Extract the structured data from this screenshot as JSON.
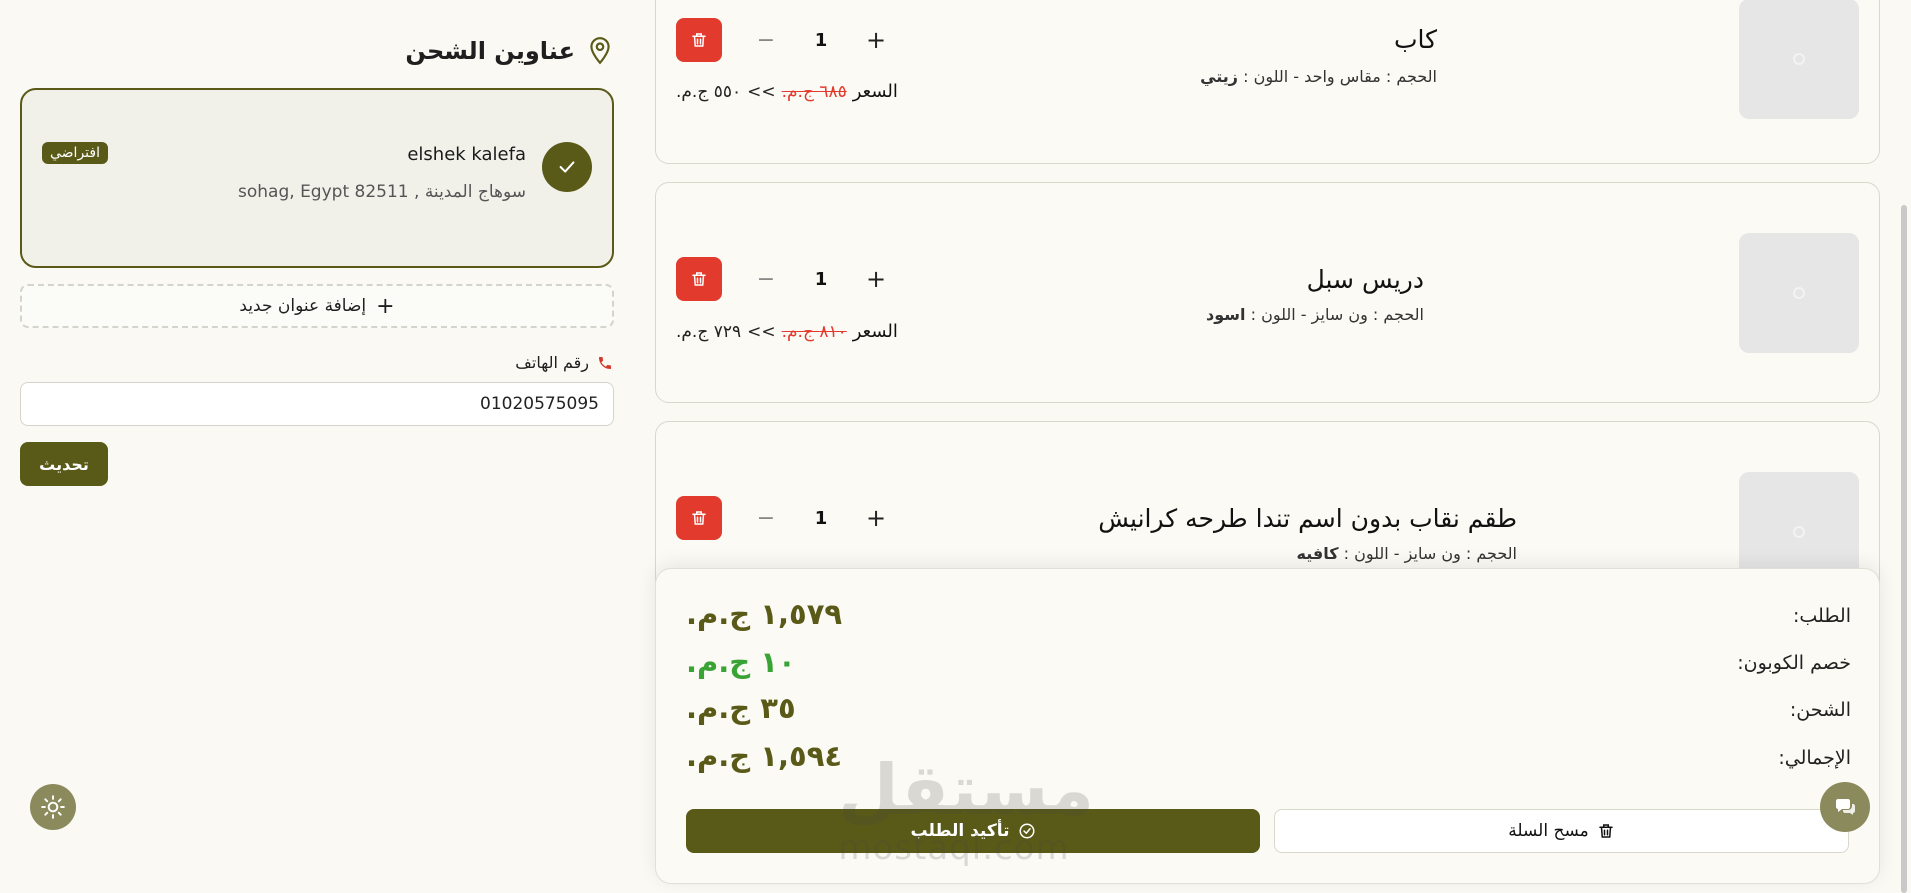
{
  "shipping": {
    "title": "عناوين الشحن",
    "address": {
      "name": "elshek kalefa",
      "line": "سوهاج المدينة , sohag, Egypt 82511",
      "badge": "افتراضي"
    },
    "add_label": "إضافة عنوان جديد",
    "phone_label": "رقم الهاتف",
    "phone_value": "01020575095",
    "update_label": "تحديث"
  },
  "cart": {
    "items": [
      {
        "name": "كاب",
        "size_label": "الحجم :",
        "size": "مقاس واحد",
        "color_label": "اللون :",
        "color": "زيتي",
        "qty": "1",
        "price_label": "السعر",
        "old_price": "٦٨٥ ج.م.",
        "arrow": ">>",
        "new_price": "٥٥٠ ج.م."
      },
      {
        "name": "دريس سبل",
        "size_label": "الحجم :",
        "size": "ون سايز",
        "color_label": "اللون :",
        "color": "اسود",
        "qty": "1",
        "price_label": "السعر",
        "old_price": "٨١٠ ج.م.",
        "arrow": ">>",
        "new_price": "٧٢٩ ج.م."
      },
      {
        "name": "طقم نقاب بدون اسم تندا طرحه كرانيش",
        "size_label": "الحجم :",
        "size": "ون سايز",
        "color_label": "اللون :",
        "color": "كافيه",
        "qty": "1"
      }
    ]
  },
  "summary": {
    "order_label": "الطلب:",
    "order_value": "١,٥٧٩ ج.م.",
    "coupon_label": "خصم الكوبون:",
    "coupon_value": "١٠ ج.م.",
    "shipping_label": "الشحن:",
    "shipping_value": "٣٥ ج.م.",
    "total_label": "الإجمالي:",
    "total_value": "١,٥٩٤ ج.م.",
    "confirm_label": "تأكيد الطلب",
    "clear_label": "مسح السلة"
  },
  "watermark": {
    "arabic": "مستقل",
    "latin": "mostaql.com"
  },
  "colors": {
    "accent": "#5a5a18",
    "danger": "#e23b2e",
    "success": "#3aa335",
    "background": "#faf9f3"
  },
  "icons": [
    "location-pin-icon",
    "check-icon",
    "plus-icon",
    "phone-icon",
    "sun-icon",
    "trash-icon",
    "minus-icon",
    "image-placeholder-icon",
    "check-circle-icon",
    "chat-icon"
  ]
}
